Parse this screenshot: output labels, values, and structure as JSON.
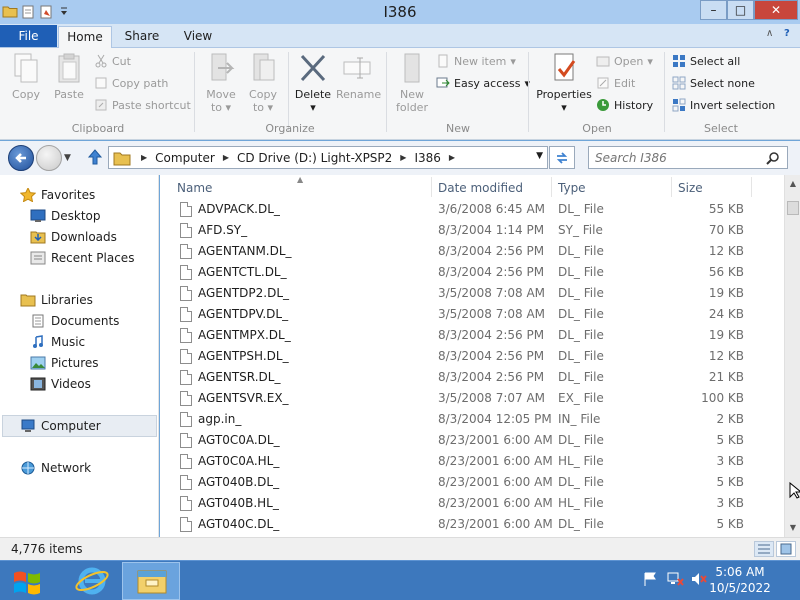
{
  "window": {
    "title": "I386",
    "minimize": "–",
    "maximize": "□",
    "close": "✕"
  },
  "ribbon_tabs": {
    "file": "File",
    "home": "Home",
    "share": "Share",
    "view": "View",
    "collapse": "∧",
    "help": "?"
  },
  "ribbon": {
    "clipboard": {
      "label": "Clipboard",
      "copy": "Copy",
      "paste": "Paste",
      "cut": "Cut",
      "copy_path": "Copy path",
      "paste_shortcut": "Paste shortcut"
    },
    "organize": {
      "label": "Organize",
      "move_to_1": "Move",
      "move_to_2": "to",
      "copy_to_1": "Copy",
      "copy_to_2": "to",
      "delete": "Delete",
      "rename": "Rename"
    },
    "new": {
      "label": "New",
      "new_folder_1": "New",
      "new_folder_2": "folder",
      "new_item": "New item",
      "easy_access": "Easy access"
    },
    "open": {
      "label": "Open",
      "properties": "Properties",
      "open": "Open",
      "edit": "Edit",
      "history": "History"
    },
    "select": {
      "label": "Select",
      "select_all": "Select all",
      "select_none": "Select none",
      "invert_selection": "Invert selection"
    }
  },
  "address": {
    "crumbs": [
      "Computer",
      "CD Drive (D:) Light-XPSP2",
      "I386"
    ],
    "search_placeholder": "Search I386"
  },
  "nav_pane": {
    "favorites": "Favorites",
    "desktop": "Desktop",
    "downloads": "Downloads",
    "recent_places": "Recent Places",
    "libraries": "Libraries",
    "documents": "Documents",
    "music": "Music",
    "pictures": "Pictures",
    "videos": "Videos",
    "computer": "Computer",
    "network": "Network"
  },
  "columns": {
    "name": "Name",
    "date_modified": "Date modified",
    "type": "Type",
    "size": "Size"
  },
  "files": [
    {
      "name": "ADVPACK.DL_",
      "date": "3/6/2008 6:45 AM",
      "type": "DL_ File",
      "size": "55 KB"
    },
    {
      "name": "AFD.SY_",
      "date": "8/3/2004 1:14 PM",
      "type": "SY_ File",
      "size": "70 KB"
    },
    {
      "name": "AGENTANM.DL_",
      "date": "8/3/2004 2:56 PM",
      "type": "DL_ File",
      "size": "12 KB"
    },
    {
      "name": "AGENTCTL.DL_",
      "date": "8/3/2004 2:56 PM",
      "type": "DL_ File",
      "size": "56 KB"
    },
    {
      "name": "AGENTDP2.DL_",
      "date": "3/5/2008 7:08 AM",
      "type": "DL_ File",
      "size": "19 KB"
    },
    {
      "name": "AGENTDPV.DL_",
      "date": "3/5/2008 7:08 AM",
      "type": "DL_ File",
      "size": "24 KB"
    },
    {
      "name": "AGENTMPX.DL_",
      "date": "8/3/2004 2:56 PM",
      "type": "DL_ File",
      "size": "19 KB"
    },
    {
      "name": "AGENTPSH.DL_",
      "date": "8/3/2004 2:56 PM",
      "type": "DL_ File",
      "size": "12 KB"
    },
    {
      "name": "AGENTSR.DL_",
      "date": "8/3/2004 2:56 PM",
      "type": "DL_ File",
      "size": "21 KB"
    },
    {
      "name": "AGENTSVR.EX_",
      "date": "3/5/2008 7:07 AM",
      "type": "EX_ File",
      "size": "100 KB"
    },
    {
      "name": "agp.in_",
      "date": "8/3/2004 12:05 PM",
      "type": "IN_ File",
      "size": "2 KB"
    },
    {
      "name": "AGT0C0A.DL_",
      "date": "8/23/2001 6:00 AM",
      "type": "DL_ File",
      "size": "5 KB"
    },
    {
      "name": "AGT0C0A.HL_",
      "date": "8/23/2001 6:00 AM",
      "type": "HL_ File",
      "size": "3 KB"
    },
    {
      "name": "AGT040B.DL_",
      "date": "8/23/2001 6:00 AM",
      "type": "DL_ File",
      "size": "5 KB"
    },
    {
      "name": "AGT040B.HL_",
      "date": "8/23/2001 6:00 AM",
      "type": "HL_ File",
      "size": "3 KB"
    },
    {
      "name": "AGT040C.DL_",
      "date": "8/23/2001 6:00 AM",
      "type": "DL_ File",
      "size": "5 KB"
    }
  ],
  "status": {
    "item_count": "4,776 items"
  },
  "taskbar": {
    "time": "5:06 AM",
    "date": "10/5/2022"
  },
  "colors": {
    "accent": "#1f5fb6",
    "taskbar": "#3d78bd",
    "close": "#c8463b"
  }
}
